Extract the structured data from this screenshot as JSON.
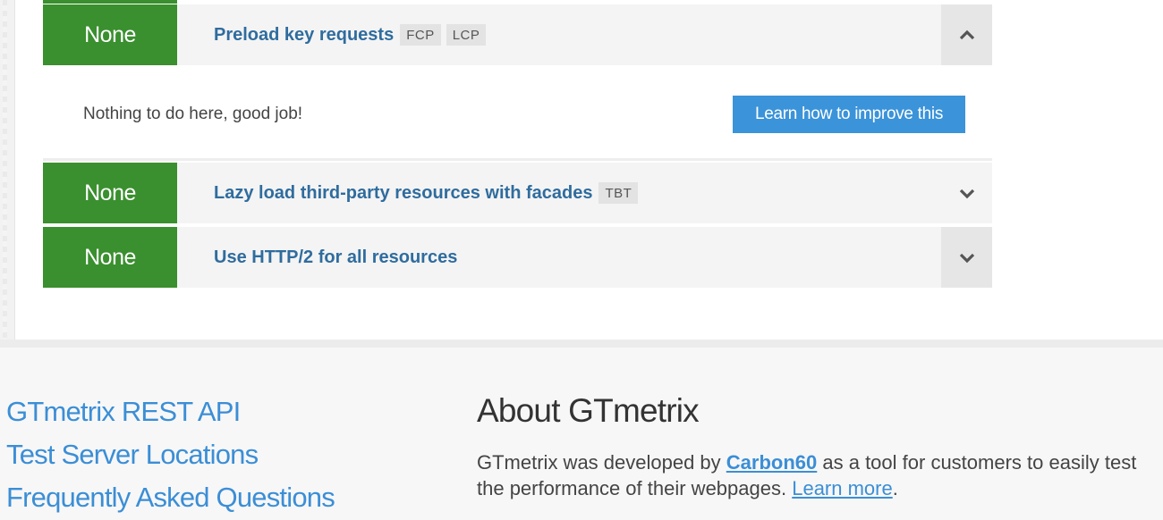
{
  "audits": [
    {
      "grade": "None",
      "title": "Preload key requests",
      "tags": [
        "FCP",
        "LCP"
      ],
      "expanded": true
    },
    {
      "grade": "None",
      "title": "Lazy load third-party resources with facades",
      "tags": [
        "TBT"
      ],
      "expanded": false
    },
    {
      "grade": "None",
      "title": "Use HTTP/2 for all resources",
      "tags": [],
      "expanded": false
    }
  ],
  "expanded_panel": {
    "message": "Nothing to do here, good job!",
    "button_label": "Learn how to improve this"
  },
  "footer": {
    "links": [
      "GTmetrix REST API",
      "Test Server Locations",
      "Frequently Asked Questions"
    ],
    "about": {
      "title": "About GTmetrix",
      "text_before": "GTmetrix was developed by ",
      "company": "Carbon60",
      "text_middle": " as a tool for customers to easily test the performance of their webpages. ",
      "learn_more": "Learn more",
      "text_after": "."
    }
  },
  "colors": {
    "grade_green": "#3a8f2e",
    "title_blue": "#2f6c9e",
    "button_blue": "#3b93d9",
    "link_blue": "#3b8ed6"
  },
  "icons": {
    "expanded_toggle": "chevron-up-icon",
    "collapsed_toggle": "chevron-down-icon"
  }
}
